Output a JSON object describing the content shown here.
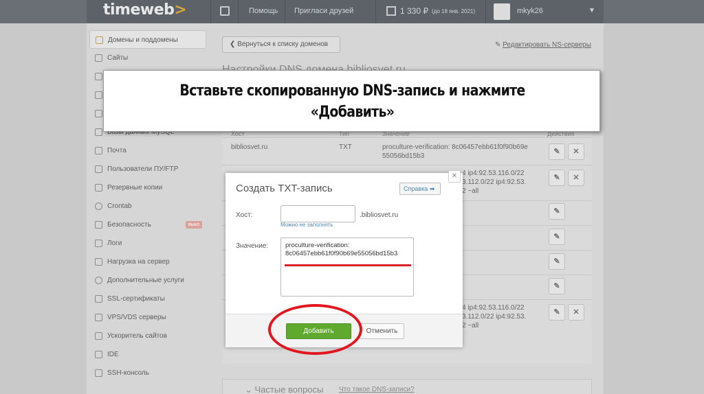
{
  "topbar": {
    "logo": "timeweb",
    "logo_arrow": ">",
    "help": "Помощь",
    "invite": "Пригласи друзей",
    "balance": "1 330",
    "currency": "₽",
    "balance_until": "(до 18 янв. 2021)",
    "username": "mkyk26"
  },
  "sidebar": {
    "items": [
      {
        "label": "Домены и поддомены"
      },
      {
        "label": "Сайты"
      },
      {
        "label": ""
      },
      {
        "label": ""
      },
      {
        "label": ""
      },
      {
        "label": "Базы данных MySQL"
      },
      {
        "label": "Почта"
      },
      {
        "label": "Пользователи ПУ/FTP"
      },
      {
        "label": "Резервные копии"
      },
      {
        "label": "Crontab"
      },
      {
        "label": "Безопасность",
        "badge": "выкл"
      },
      {
        "label": "Логи"
      },
      {
        "label": "Нагрузка на сервер"
      },
      {
        "label": "Дополнительные услуги"
      },
      {
        "label": "SSL-сертификаты"
      },
      {
        "label": "VPS/VDS серверы"
      },
      {
        "label": "Ускоритель сайтов"
      },
      {
        "label": "IDE"
      },
      {
        "label": "SSH-консоль"
      }
    ]
  },
  "main": {
    "back_label": "Вернуться к списку доменов",
    "edit_ns_label": "Редактировать NS-серверы",
    "title": "Настройки DNS домена bibliosvet.ru",
    "columns": {
      "host": "Хост",
      "type": "Тип",
      "value": "Значение",
      "actions": "Действия"
    },
    "rows": [
      {
        "host": "bibliosvet.ru",
        "type": "TXT",
        "value_line1": "proculture-verification: 8c06457ebb61f0f90b69e",
        "value_line2": "55056bd15b3"
      },
      {
        "host": "",
        "type": "",
        "value_line1": "4 ip4:92.53.116.0/22",
        "value_line2": "3.112.0/22 ip4:92.53.",
        "value_line3": "2 ~all"
      },
      {
        "host": "",
        "type": "",
        "value_line1": "",
        "value_line2": ""
      },
      {
        "host": "",
        "type": "",
        "value_line1": "",
        "value_line2": ""
      },
      {
        "host": "",
        "type": "",
        "value_line1": "",
        "value_line2": ""
      },
      {
        "host": "",
        "type": "",
        "value_line1": "",
        "value_line2": ""
      },
      {
        "host": "",
        "type": "",
        "value_line1": "4 ip4:92.53.116.0/22",
        "value_line2": "3.112.0/22 ip4:92.53.",
        "value_line3": "2 ~all"
      }
    ],
    "faq_title": "Частые вопросы",
    "faq_link": "Что такое DNS-записи?"
  },
  "banner": {
    "line1": "Вставьте скопированную DNS-запись и нажмите",
    "line2": "«Добавить»"
  },
  "modal": {
    "title": "Создать TXT-запись",
    "help_label": "Справка",
    "host_label": "Хост:",
    "host_value": "",
    "domain_suffix": ".bibliosvet.ru",
    "host_hint": "Можно не заполнять",
    "value_label": "Значение:",
    "value_line1": "proculture-verification:",
    "value_line2": "8c06457ebb61f0f90b69e55056bd15b3",
    "add_label": "Добавить",
    "cancel_label": "Отменить"
  },
  "colors": {
    "add_button": "#5faa2e",
    "highlight_red": "#e2161e",
    "link_blue": "#4a8ab8"
  }
}
